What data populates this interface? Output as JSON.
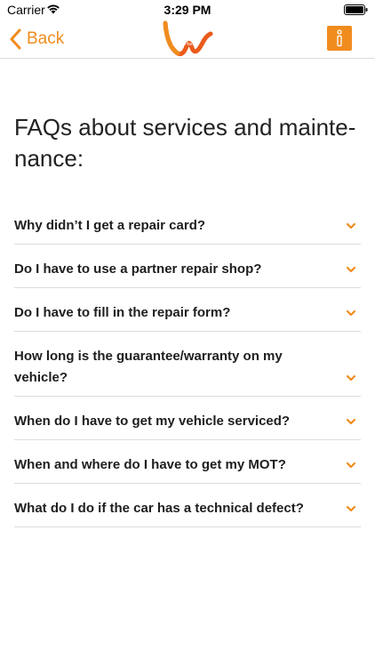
{
  "status_bar": {
    "carrier": "Carrier",
    "time": "3:29 PM"
  },
  "nav": {
    "back_label": "Back",
    "logo_text": "LeasePlan"
  },
  "page": {
    "title": "FAQs about services and mainte-nance:"
  },
  "faqs": [
    {
      "question": "Why didn’t I get a repair card?"
    },
    {
      "question": "Do I have to use a partner repair shop?"
    },
    {
      "question": "Do I have to fill in the repair form?"
    },
    {
      "question": "How long is the guarantee/warranty on my vehicle?"
    },
    {
      "question": "When do I have to get my vehicle serviced?"
    },
    {
      "question": "When and where do I have to get my MOT?"
    },
    {
      "question": "What do I do if the car has a technical defect?"
    }
  ],
  "colors": {
    "accent": "#f08c1e",
    "divider": "#dcdcdc",
    "text": "#1e1e1e"
  }
}
